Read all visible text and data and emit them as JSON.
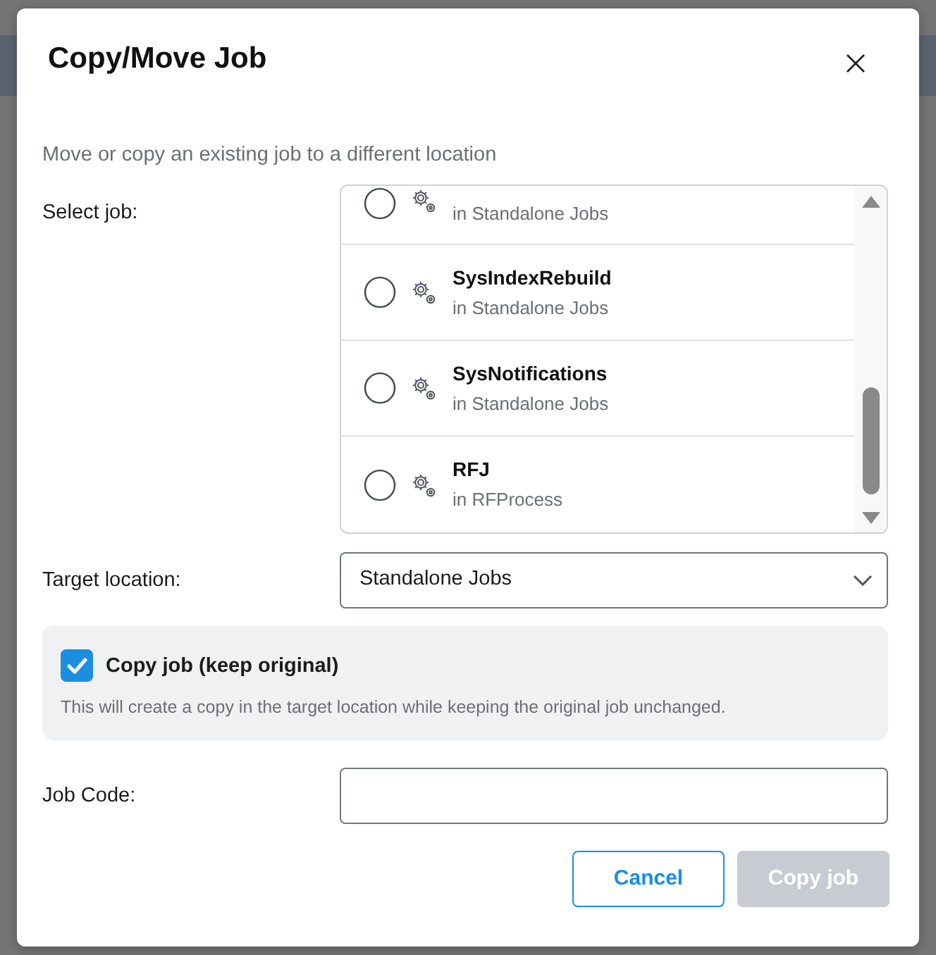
{
  "dialog": {
    "title": "Copy/Move Job",
    "description": "Move or copy an existing job to a different location"
  },
  "select_job": {
    "label": "Select job:",
    "jobs": [
      {
        "location": "in Standalone Jobs",
        "selected": false
      },
      {
        "name": "SysIndexRebuild",
        "location": "in Standalone Jobs",
        "selected": false
      },
      {
        "name": "SysNotifications",
        "location": "in Standalone Jobs",
        "selected": false
      },
      {
        "name": "RFJ",
        "location": "in RFProcess",
        "selected": false
      }
    ]
  },
  "target_location": {
    "label": "Target location:",
    "value": "Standalone Jobs"
  },
  "copy_option": {
    "label": "Copy job (keep original)",
    "checked": true,
    "help": "This will create a copy in the target location while keeping the original job unchanged."
  },
  "job_code": {
    "label": "Job Code:"
  },
  "buttons": [
    {
      "kind": "secondary",
      "label": "Cancel",
      "disabled": false
    },
    {
      "kind": "primary",
      "label": "Copy job",
      "disabled": true
    }
  ]
}
